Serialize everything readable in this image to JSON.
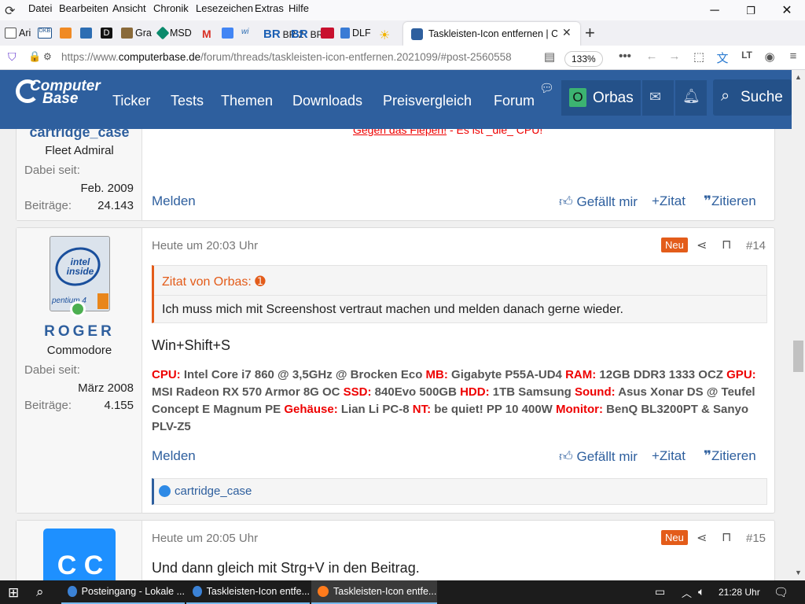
{
  "menu": [
    "Datei",
    "Bearbeiten",
    "Ansicht",
    "Chronik",
    "Lesezeichen",
    "Extras",
    "Hilfe"
  ],
  "bookmarks": [
    "Ari",
    "DKB",
    "",
    "",
    "",
    "Gra",
    "MSD",
    "",
    "",
    "",
    "BR 2",
    "BR 5",
    "",
    "DLF",
    ""
  ],
  "tab": {
    "title": "Taskleisten-Icon entfernen | Co"
  },
  "url": {
    "prefix": "https://www.",
    "domain": "computerbase.de",
    "path": "/forum/threads/taskleisten-icon-entfernen.2021099/#post-2560558",
    "zoom": "133%"
  },
  "site": {
    "logo_top": "Computer",
    "logo_bottom": "Base",
    "nav": [
      "Ticker",
      "Tests",
      "Themen",
      "Downloads",
      "Preisvergleich",
      "Forum"
    ],
    "user_initial": "O",
    "user_name": "Orbas",
    "search_label": "Suche"
  },
  "post_prev": {
    "username": "cartridge_case",
    "rank": "Fleet Admiral",
    "joined_label": "Dabei seit:",
    "joined": "Feb. 2009",
    "posts_label": "Beiträge:",
    "posts": "24.143",
    "sig_link": "Gegen das Fiepen!",
    "sig_tail": " - Es ist _die_ CPU!",
    "report": "Melden",
    "like": "Gefällt mir",
    "plus_quote": "+Zitat",
    "quote": "Zitieren"
  },
  "post14": {
    "avatar_text": "intel inside",
    "avatar_sub": "pentium 4",
    "username": "ROGER",
    "rank": "Commodore",
    "joined_label": "Dabei seit:",
    "joined": "März 2008",
    "posts_label": "Beiträge:",
    "posts": "4.155",
    "date": "Heute um 20:03 Uhr",
    "badge": "Neu",
    "number": "#14",
    "quote_head": "Zitat von Orbas:",
    "quote_body": "Ich muss mich mit Screenshost vertraut machen und melden danach gerne wieder.",
    "body": "Win+Shift+S",
    "sig": [
      {
        "k": "CPU:",
        "v": " Intel Core i7 860 @ 3,5GHz @ Brocken Eco "
      },
      {
        "k": "MB:",
        "v": " Gigabyte P55A-UD4 "
      },
      {
        "k": "RAM:",
        "v": " 12GB DDR3 1333 OCZ "
      },
      {
        "k": "GPU:",
        "v": " MSI Radeon RX 570 Armor 8G OC "
      },
      {
        "k": "SSD:",
        "v": " 840Evo 500GB "
      },
      {
        "k": "HDD:",
        "v": " 1TB Samsung "
      },
      {
        "k": "Sound:",
        "v": " Asus Xonar DS @ Teufel Concept E Magnum PE "
      },
      {
        "k": "Gehäuse:",
        "v": " Lian Li PC-8 "
      },
      {
        "k": "NT:",
        "v": " be quiet! PP 10 400W "
      },
      {
        "k": "Monitor:",
        "v": " BenQ BL3200PT & Sanyo PLV-Z5"
      }
    ],
    "report": "Melden",
    "like": "Gefällt mir",
    "plus_quote": "+Zitat",
    "quote": "Zitieren",
    "reaction_user": "cartridge_case"
  },
  "post15": {
    "avatar_text": "C  C",
    "date": "Heute um 20:05 Uhr",
    "badge": "Neu",
    "number": "#15",
    "body": "Und dann gleich mit Strg+V in den Beitrag."
  },
  "taskbar": {
    "apps": [
      "Posteingang - Lokale ...",
      "Taskleisten-Icon entfe...",
      "Taskleisten-Icon entfe..."
    ],
    "time": "21:28 Uhr"
  },
  "colors": {
    "brand": "#2e5f9e",
    "accent": "#e35c1a",
    "sig_key": "#e00"
  }
}
